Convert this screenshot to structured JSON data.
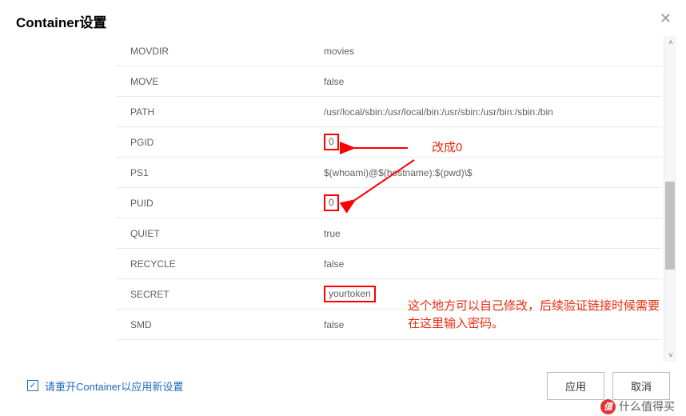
{
  "dialog_title": "Container设置",
  "rows": [
    {
      "k": "MOVDIR",
      "v": "movies"
    },
    {
      "k": "MOVE",
      "v": "false"
    },
    {
      "k": "PATH",
      "v": "/usr/local/sbin:/usr/local/bin:/usr/sbin:/usr/bin:/sbin:/bin"
    },
    {
      "k": "PGID",
      "v": "0"
    },
    {
      "k": "PS1",
      "v": "$(whoami)@$(hostname):$(pwd)\\$"
    },
    {
      "k": "PUID",
      "v": "0"
    },
    {
      "k": "QUIET",
      "v": "true"
    },
    {
      "k": "RECYCLE",
      "v": "false"
    },
    {
      "k": "SECRET",
      "v": "yourtoken"
    },
    {
      "k": "SMD",
      "v": "false"
    }
  ],
  "annotations": {
    "change_to_zero": "改成0",
    "secret_note": "这个地方可以自己修改，后续验证链接时候需要在这里输入密码。"
  },
  "restart_checkbox_label": "请重开Container以应用新设置",
  "buttons": {
    "apply": "应用",
    "cancel": "取消"
  },
  "watermark_text": "什么值得买"
}
